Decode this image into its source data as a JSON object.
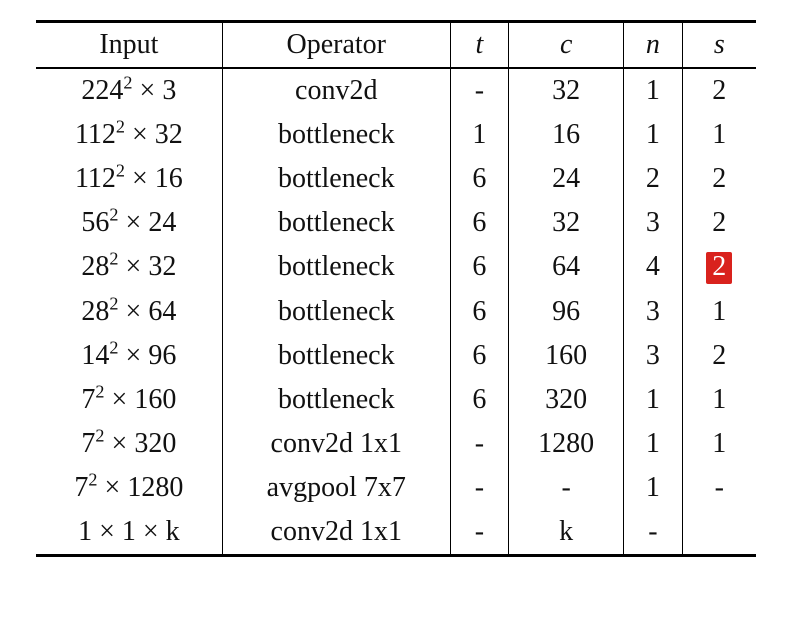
{
  "headers": {
    "input": "Input",
    "operator": "Operator",
    "t": "t",
    "c": "c",
    "n": "n",
    "s": "s"
  },
  "rows": [
    {
      "input_base": "224",
      "input_exp": "2",
      "input_ch": "3",
      "operator": "conv2d",
      "t": "-",
      "c": "32",
      "n": "1",
      "s": "2",
      "s_hl": false
    },
    {
      "input_base": "112",
      "input_exp": "2",
      "input_ch": "32",
      "operator": "bottleneck",
      "t": "1",
      "c": "16",
      "n": "1",
      "s": "1",
      "s_hl": false
    },
    {
      "input_base": "112",
      "input_exp": "2",
      "input_ch": "16",
      "operator": "bottleneck",
      "t": "6",
      "c": "24",
      "n": "2",
      "s": "2",
      "s_hl": false
    },
    {
      "input_base": "56",
      "input_exp": "2",
      "input_ch": "24",
      "operator": "bottleneck",
      "t": "6",
      "c": "32",
      "n": "3",
      "s": "2",
      "s_hl": false
    },
    {
      "input_base": "28",
      "input_exp": "2",
      "input_ch": "32",
      "operator": "bottleneck",
      "t": "6",
      "c": "64",
      "n": "4",
      "s": "2",
      "s_hl": true
    },
    {
      "input_base": "28",
      "input_exp": "2",
      "input_ch": "64",
      "operator": "bottleneck",
      "t": "6",
      "c": "96",
      "n": "3",
      "s": "1",
      "s_hl": false
    },
    {
      "input_base": "14",
      "input_exp": "2",
      "input_ch": "96",
      "operator": "bottleneck",
      "t": "6",
      "c": "160",
      "n": "3",
      "s": "2",
      "s_hl": false
    },
    {
      "input_base": "7",
      "input_exp": "2",
      "input_ch": "160",
      "operator": "bottleneck",
      "t": "6",
      "c": "320",
      "n": "1",
      "s": "1",
      "s_hl": false
    },
    {
      "input_base": "7",
      "input_exp": "2",
      "input_ch": "320",
      "operator": "conv2d 1x1",
      "t": "-",
      "c": "1280",
      "n": "1",
      "s": "1",
      "s_hl": false
    },
    {
      "input_base": "7",
      "input_exp": "2",
      "input_ch": "1280",
      "operator": "avgpool 7x7",
      "t": "-",
      "c": "-",
      "n": "1",
      "s": "-",
      "s_hl": false
    },
    {
      "input_plain": "1 × 1 × k",
      "operator": "conv2d 1x1",
      "t": "-",
      "c": "k",
      "n": "-",
      "s": "",
      "s_hl": false
    }
  ],
  "chart_data": {
    "type": "table",
    "title": "MobileNetV2 architecture specification",
    "columns": [
      "Input",
      "Operator",
      "t",
      "c",
      "n",
      "s"
    ],
    "rows": [
      [
        "224^2 × 3",
        "conv2d",
        "-",
        32,
        1,
        2
      ],
      [
        "112^2 × 32",
        "bottleneck",
        1,
        16,
        1,
        1
      ],
      [
        "112^2 × 16",
        "bottleneck",
        6,
        24,
        2,
        2
      ],
      [
        "56^2 × 24",
        "bottleneck",
        6,
        32,
        3,
        2
      ],
      [
        "28^2 × 32",
        "bottleneck",
        6,
        64,
        4,
        2
      ],
      [
        "28^2 × 64",
        "bottleneck",
        6,
        96,
        3,
        1
      ],
      [
        "14^2 × 96",
        "bottleneck",
        6,
        160,
        3,
        2
      ],
      [
        "7^2 × 160",
        "bottleneck",
        6,
        320,
        1,
        1
      ],
      [
        "7^2 × 320",
        "conv2d 1x1",
        "-",
        1280,
        1,
        1
      ],
      [
        "7^2 × 1280",
        "avgpool 7x7",
        "-",
        "-",
        1,
        "-"
      ],
      [
        "1 × 1 × k",
        "conv2d 1x1",
        "-",
        "k",
        "-",
        ""
      ]
    ],
    "notes": "Cell (row 5, s=2) is highlighted in red."
  },
  "watermark": ""
}
